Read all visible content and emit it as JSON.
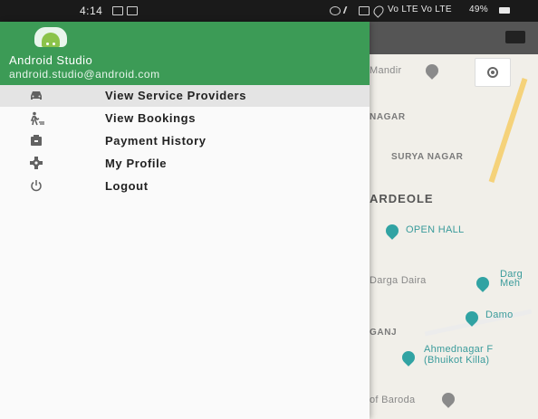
{
  "status_bar": {
    "time": "4:14",
    "network_text": "Vo LTE  Vo LTE",
    "battery": "49%"
  },
  "drawer": {
    "user_name": "Android Studio",
    "user_email": "android.studio@android.com",
    "menu_items": [
      {
        "label": "View Service Providers",
        "icon": "car-icon",
        "selected": true
      },
      {
        "label": "View Bookings",
        "icon": "person-walking-icon",
        "selected": false
      },
      {
        "label": "Payment History",
        "icon": "wallet-icon",
        "selected": false
      },
      {
        "label": "My Profile",
        "icon": "gear-icon",
        "selected": false
      },
      {
        "label": "Logout",
        "icon": "power-icon",
        "selected": false
      }
    ]
  },
  "map": {
    "labels": {
      "mandir": "Mandir",
      "nagar": "NAGAR",
      "surya_nagar": "SURYA NAGAR",
      "ardeole": "ARDEOLE",
      "open_hall": "OPEN HALL",
      "darga_daira": "Darga Daira",
      "darga_mehr": "Darg\nMeh",
      "damo": "Damo",
      "ganj": "GANJ",
      "ahmednagar_fort_1": "Ahmednagar F",
      "ahmednagar_fort_2": "(Bhuikot Killa)",
      "of_baroda": "of Baroda"
    }
  }
}
